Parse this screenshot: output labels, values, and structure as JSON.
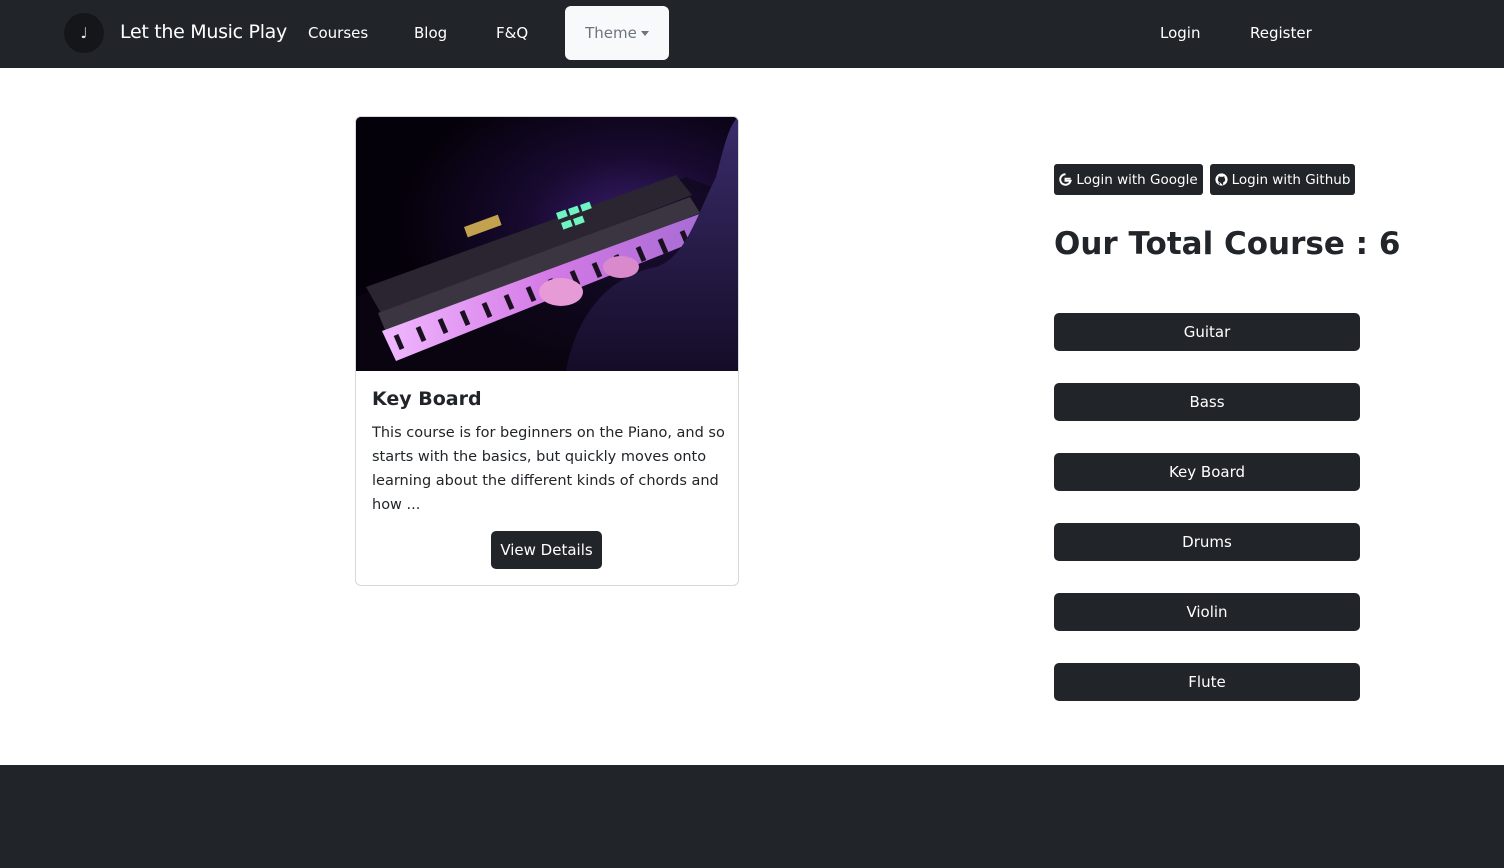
{
  "navbar": {
    "logo_glyph": "♩",
    "brand": "Let the Music Play",
    "links": [
      "Courses",
      "Blog",
      "F&Q"
    ],
    "theme_label": "Theme",
    "login": "Login",
    "register": "Register"
  },
  "card": {
    "image_icon": "keyboard-photo",
    "title": "Key Board",
    "description": "This course is for beginners on the Piano, and so starts with the basics, but quickly moves onto learning about the different kinds of chords and how ...",
    "button": "View Details"
  },
  "sidebar": {
    "google_button": "Login with Google",
    "github_button": "Login with Github",
    "total_heading": "Our Total Course : 6",
    "courses": [
      "Guitar",
      "Bass",
      "Key Board",
      "Drums",
      "Violin",
      "Flute"
    ]
  },
  "colors": {
    "dark": "#212529",
    "light": "#f8f9fa",
    "muted": "#6c757d"
  }
}
